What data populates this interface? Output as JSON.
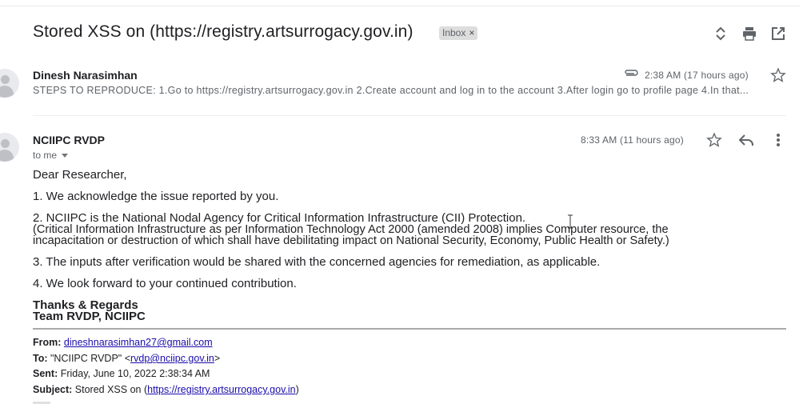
{
  "thread": {
    "subject": "Stored XSS on (https://registry.artsurrogacy.gov.in)",
    "label": "Inbox",
    "label_close": "×"
  },
  "message1": {
    "sender": "Dinesh Narasimhan",
    "time": "2:38 AM (17 hours ago)",
    "snippet": "STEPS TO REPRODUCE: 1.Go to https://registry.artsurrogacy.gov.in 2.Create account and log in to the account 3.After login go to profile page 4.In that..."
  },
  "message2": {
    "sender": "NCIIPC RVDP",
    "recipient": "to me",
    "time": "8:33 AM (11 hours ago)",
    "greeting": "Dear Researcher,",
    "p1": "1. We acknowledge the issue reported by you.",
    "p2_line1": "2. NCIIPC is the National Nodal Agency for Critical Information Infrastructure (CII) Protection.",
    "p2_line2": "(Critical Information Infrastructure as per Information Technology Act 2000 (amended 2008) implies Computer resource, the",
    "p2_line3": "incapacitation or destruction of which shall have debilitating impact on National Security, Economy, Public Health or Safety.)",
    "p3": "3. The inputs after verification would be shared with the concerned agencies for remediation, as applicable.",
    "p4": "4. We look forward to your continued contribution.",
    "signoff1": "Thanks & Regards",
    "signoff2": "Team RVDP, NCIIPC"
  },
  "quoted": {
    "from_label": "From:",
    "from_value": "dineshnarasimhan27@gmail.com",
    "to_label": "To:",
    "to_name": "\"NCIIPC RVDP\" <",
    "to_email": "rvdp@nciipc.gov.in",
    "to_end": ">",
    "sent_label": "Sent:",
    "sent_value": "Friday, June 10, 2022 2:38:34 AM",
    "subject_label": "Subject:",
    "subject_prefix": "Stored XSS on (",
    "subject_link": "https://registry.artsurrogacy.gov.in",
    "subject_suffix": ")"
  },
  "icons": {
    "expand": "unfold-icon",
    "print": "print-icon",
    "open_new": "open-in-new-icon",
    "attachment": "attachment-icon",
    "star": "star-icon",
    "reply": "reply-icon",
    "more": "more-vert-icon"
  }
}
